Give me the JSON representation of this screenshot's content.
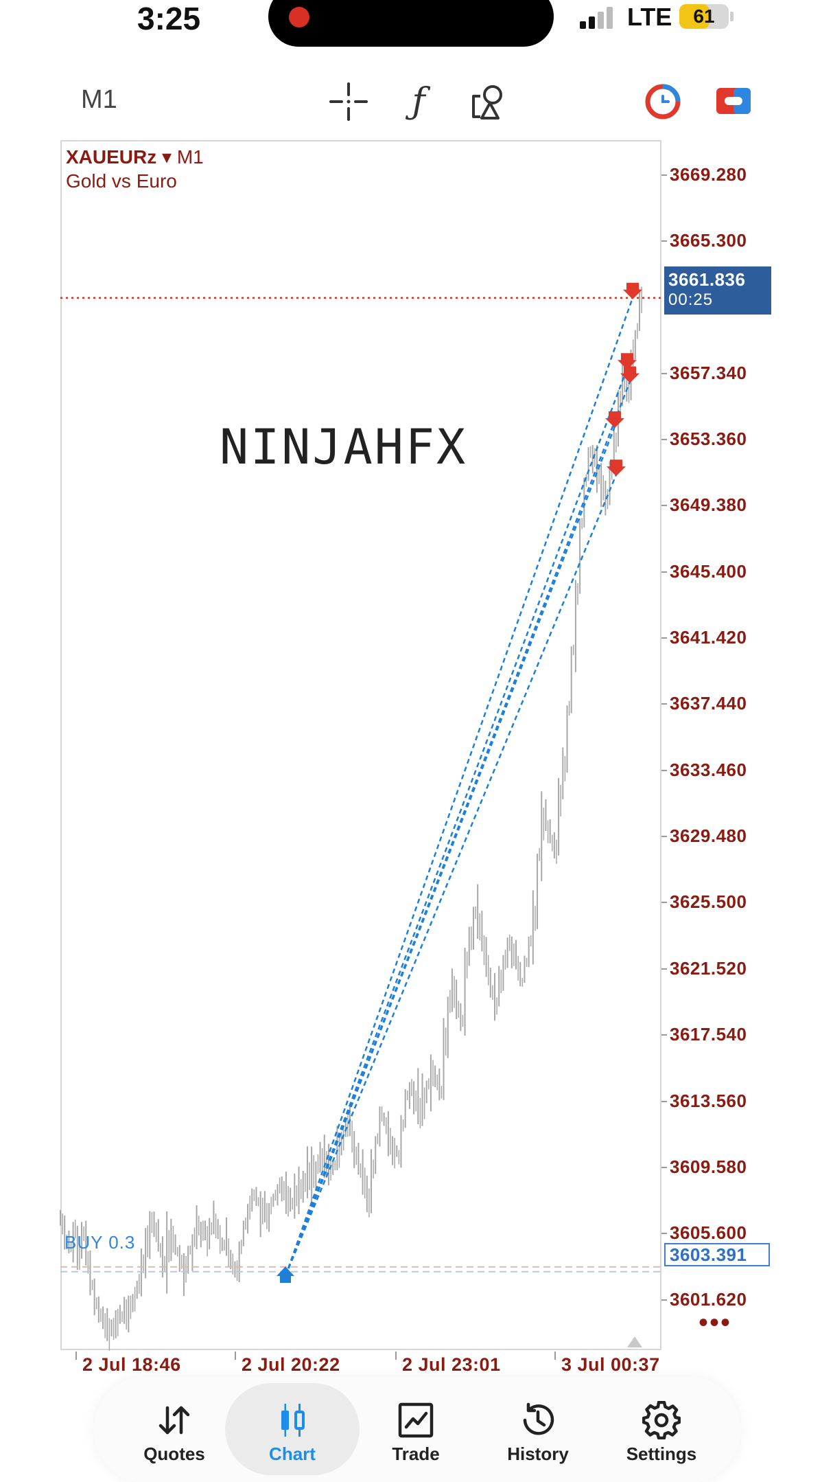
{
  "status_bar": {
    "time": "3:25",
    "network": "LTE",
    "battery": "61",
    "battery_level_percent": 61
  },
  "toolbar": {
    "timeframe": "M1",
    "function_glyph": "ƒ",
    "icons": [
      "crosshair-icon",
      "indicator-function-icon",
      "objects-icon",
      "one-click-trading-icon",
      "trade-icon"
    ]
  },
  "chart": {
    "symbol": "XAUEURz",
    "dropdown_glyph": "▾",
    "timeframe": "M1",
    "description": "Gold vs Euro",
    "watermark": "NINJAHFX",
    "price_labels": [
      "3669.280",
      "3665.300",
      "3657.340",
      "3653.360",
      "3649.380",
      "3645.400",
      "3641.420",
      "3637.440",
      "3633.460",
      "3629.480",
      "3625.500",
      "3621.520",
      "3617.540",
      "3613.560",
      "3609.580",
      "3605.600",
      "3601.620"
    ],
    "current_price": "3661.836",
    "countdown": "00:25",
    "position_label": "BUY 0.3",
    "position_price": "3603.391",
    "more_label": "•••",
    "time_labels": [
      "2 Jul 18:46",
      "2 Jul 20:22",
      "2 Jul 23:01",
      "3 Jul 00:37"
    ],
    "colors": {
      "axis_text": "#8b1a10",
      "current_price_bg": "#2e5d9b",
      "trade_line": "#1e7fd8",
      "sell_arrow": "#e0392b",
      "buy_arrow": "#1e7fd8",
      "candles": "#a8a8a8"
    }
  },
  "chart_data": {
    "type": "bar",
    "x": [
      "2 Jul 18:46",
      "2 Jul 20:22",
      "2 Jul 23:01",
      "3 Jul 00:37"
    ],
    "y_ticks": [
      3669.28,
      3665.3,
      3657.34,
      3653.36,
      3649.38,
      3645.4,
      3641.42,
      3637.44,
      3633.46,
      3629.48,
      3625.5,
      3621.52,
      3617.54,
      3613.56,
      3609.58,
      3605.6,
      3601.62
    ],
    "ylim": [
      3599.0,
      3670.5
    ],
    "current_price": 3661.836,
    "position": {
      "side": "BUY",
      "volume": 0.3,
      "price": 3603.391
    },
    "series": [
      {
        "values": [
          3606.2,
          3605.1,
          3604.8,
          3605.9,
          3604.2,
          3605.6,
          3603.9,
          3602.5,
          3601.4,
          3600.7,
          3600.1,
          3599.6,
          3599.9,
          3600.3,
          3600.6,
          3600.8,
          3601.2,
          3601.7,
          3602.6,
          3603.8,
          3605.2,
          3606.3,
          3605.7,
          3604.6,
          3603.8,
          3604.9,
          3605.3,
          3604.5,
          3603.9,
          3603.5,
          3604.6,
          3605.4,
          3606.1,
          3605.8,
          3605.2,
          3605.9,
          3606.1,
          3605.3,
          3604.9,
          3604.5,
          3603.8,
          3603.4,
          3604.8,
          3606.2,
          3607.2,
          3607.9,
          3607.5,
          3607.0,
          3606.7,
          3607.3,
          3607.9,
          3608.5,
          3608.2,
          3607.6,
          3607.4,
          3607.9,
          3608.3,
          3608.7,
          3609.1,
          3609.4,
          3609.8,
          3610.1,
          3609.8,
          3609.4,
          3609.7,
          3610.6,
          3611.4,
          3612.1,
          3611.5,
          3610.3,
          3609.4,
          3608.7,
          3607.5,
          3609.5,
          3611.3,
          3612.8,
          3612.1,
          3611.2,
          3610.5,
          3610.2,
          3612.1,
          3613.9,
          3614.4,
          3613.6,
          3612.9,
          3613.5,
          3614.6,
          3615.3,
          3614.7,
          3614.1,
          3617.2,
          3619.6,
          3620.2,
          3619.1,
          3618.4,
          3621.8,
          3623.4,
          3624.9,
          3624.1,
          3622.7,
          3621.5,
          3620.1,
          3619.3,
          3620.8,
          3622.1,
          3623.1,
          3622.4,
          3621.6,
          3620.7,
          3621.9,
          3623.2,
          3624.6,
          3628.4,
          3630.3,
          3629.8,
          3629.1,
          3628.6,
          3631.7,
          3633.6,
          3637.2,
          3640.7,
          3644.1,
          3648.3,
          3650.9,
          3652.6,
          3652.3,
          3651.3,
          3650.5,
          3649.8,
          3651.4,
          3653.2,
          3655.7,
          3657.1,
          3656.4,
          3658.6,
          3659.9,
          3661.8
        ]
      }
    ],
    "trades": [
      {
        "entry": 3603.0,
        "exit": 3661.836
      },
      {
        "entry": 3603.0,
        "exit": 3657.6
      },
      {
        "entry": 3603.0,
        "exit": 3656.8
      },
      {
        "entry": 3603.0,
        "exit": 3654.1
      },
      {
        "entry": 3603.0,
        "exit": 3651.2
      }
    ]
  },
  "tabs": [
    {
      "label": "Quotes",
      "icon": "quotes-icon",
      "active": false
    },
    {
      "label": "Chart",
      "icon": "chart-icon",
      "active": true
    },
    {
      "label": "Trade",
      "icon": "trade-icon",
      "active": false
    },
    {
      "label": "History",
      "icon": "history-icon",
      "active": false
    },
    {
      "label": "Settings",
      "icon": "settings-icon",
      "active": false
    }
  ]
}
